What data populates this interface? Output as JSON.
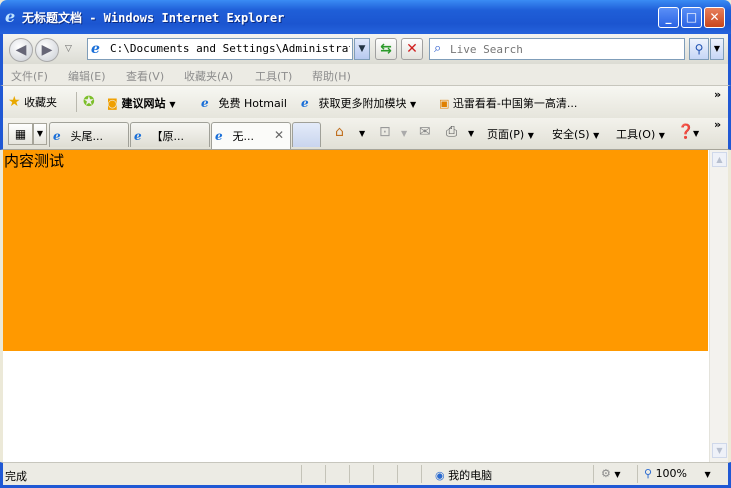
{
  "window": {
    "title": "无标题文档 - Windows Internet Explorer",
    "buttons": {
      "minimize": "_",
      "maximize": "□",
      "close": "✕"
    }
  },
  "address_bar": {
    "url": "C:\\Documents and Settings\\Administrator.",
    "search_placeholder": "Live Search"
  },
  "menu": [
    "文件(F)",
    "编辑(E)",
    "查看(V)",
    "收藏夹(A)",
    "工具(T)",
    "帮助(H)"
  ],
  "favorites_bar": {
    "favorites_label": "收藏夹",
    "items": [
      "建议网站",
      "免费 Hotmail",
      "获取更多附加模块",
      "迅雷看看-中国第一高清..."
    ]
  },
  "tabs": [
    {
      "label": "头尾...",
      "active": false
    },
    {
      "label": "【原...",
      "active": false
    },
    {
      "label": "无...",
      "active": true
    }
  ],
  "command_bar": {
    "page": "页面(P)",
    "safety": "安全(S)",
    "tools": "工具(O)"
  },
  "page": {
    "content_text": "内容测试",
    "box_color": "#ff9900"
  },
  "status_bar": {
    "status": "完成",
    "zone": "我的电脑",
    "zoom": "100%"
  }
}
